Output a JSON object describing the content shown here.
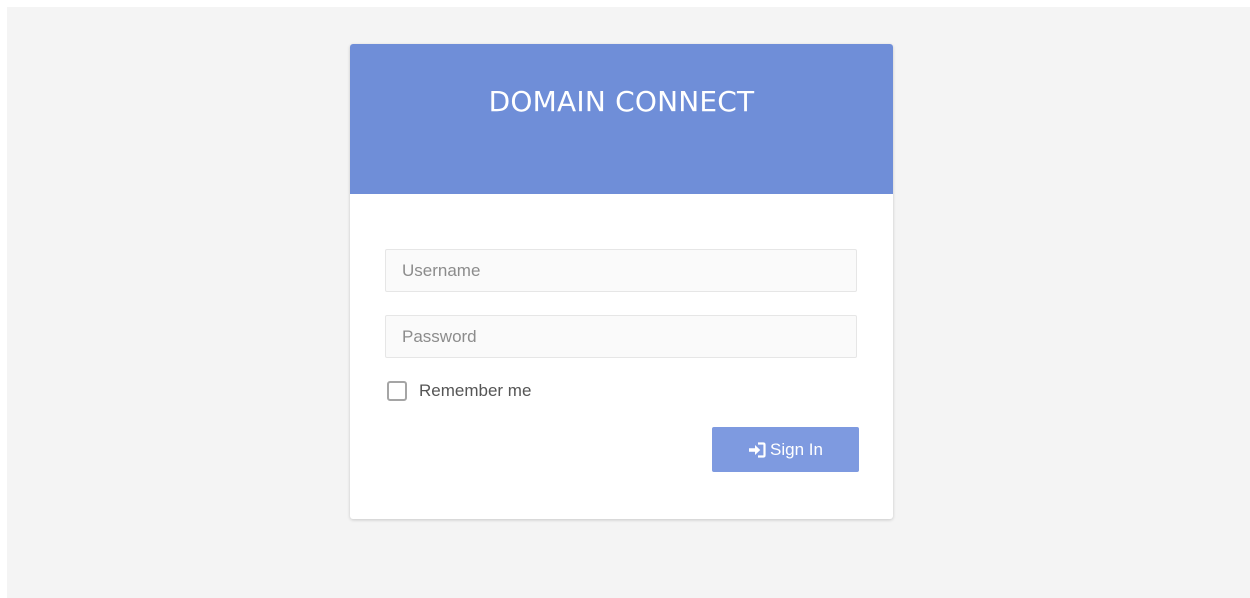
{
  "login": {
    "title": "DOMAIN CONNECT",
    "username": {
      "placeholder": "Username",
      "value": ""
    },
    "password": {
      "placeholder": "Password",
      "value": ""
    },
    "remember_me": {
      "label": "Remember me",
      "checked": false
    },
    "signin": {
      "label": "Sign In",
      "icon": "sign-in-icon"
    }
  },
  "colors": {
    "header": "#6f8ed8",
    "button": "#7e9ae0",
    "background": "#f4f4f4",
    "card": "#ffffff"
  }
}
